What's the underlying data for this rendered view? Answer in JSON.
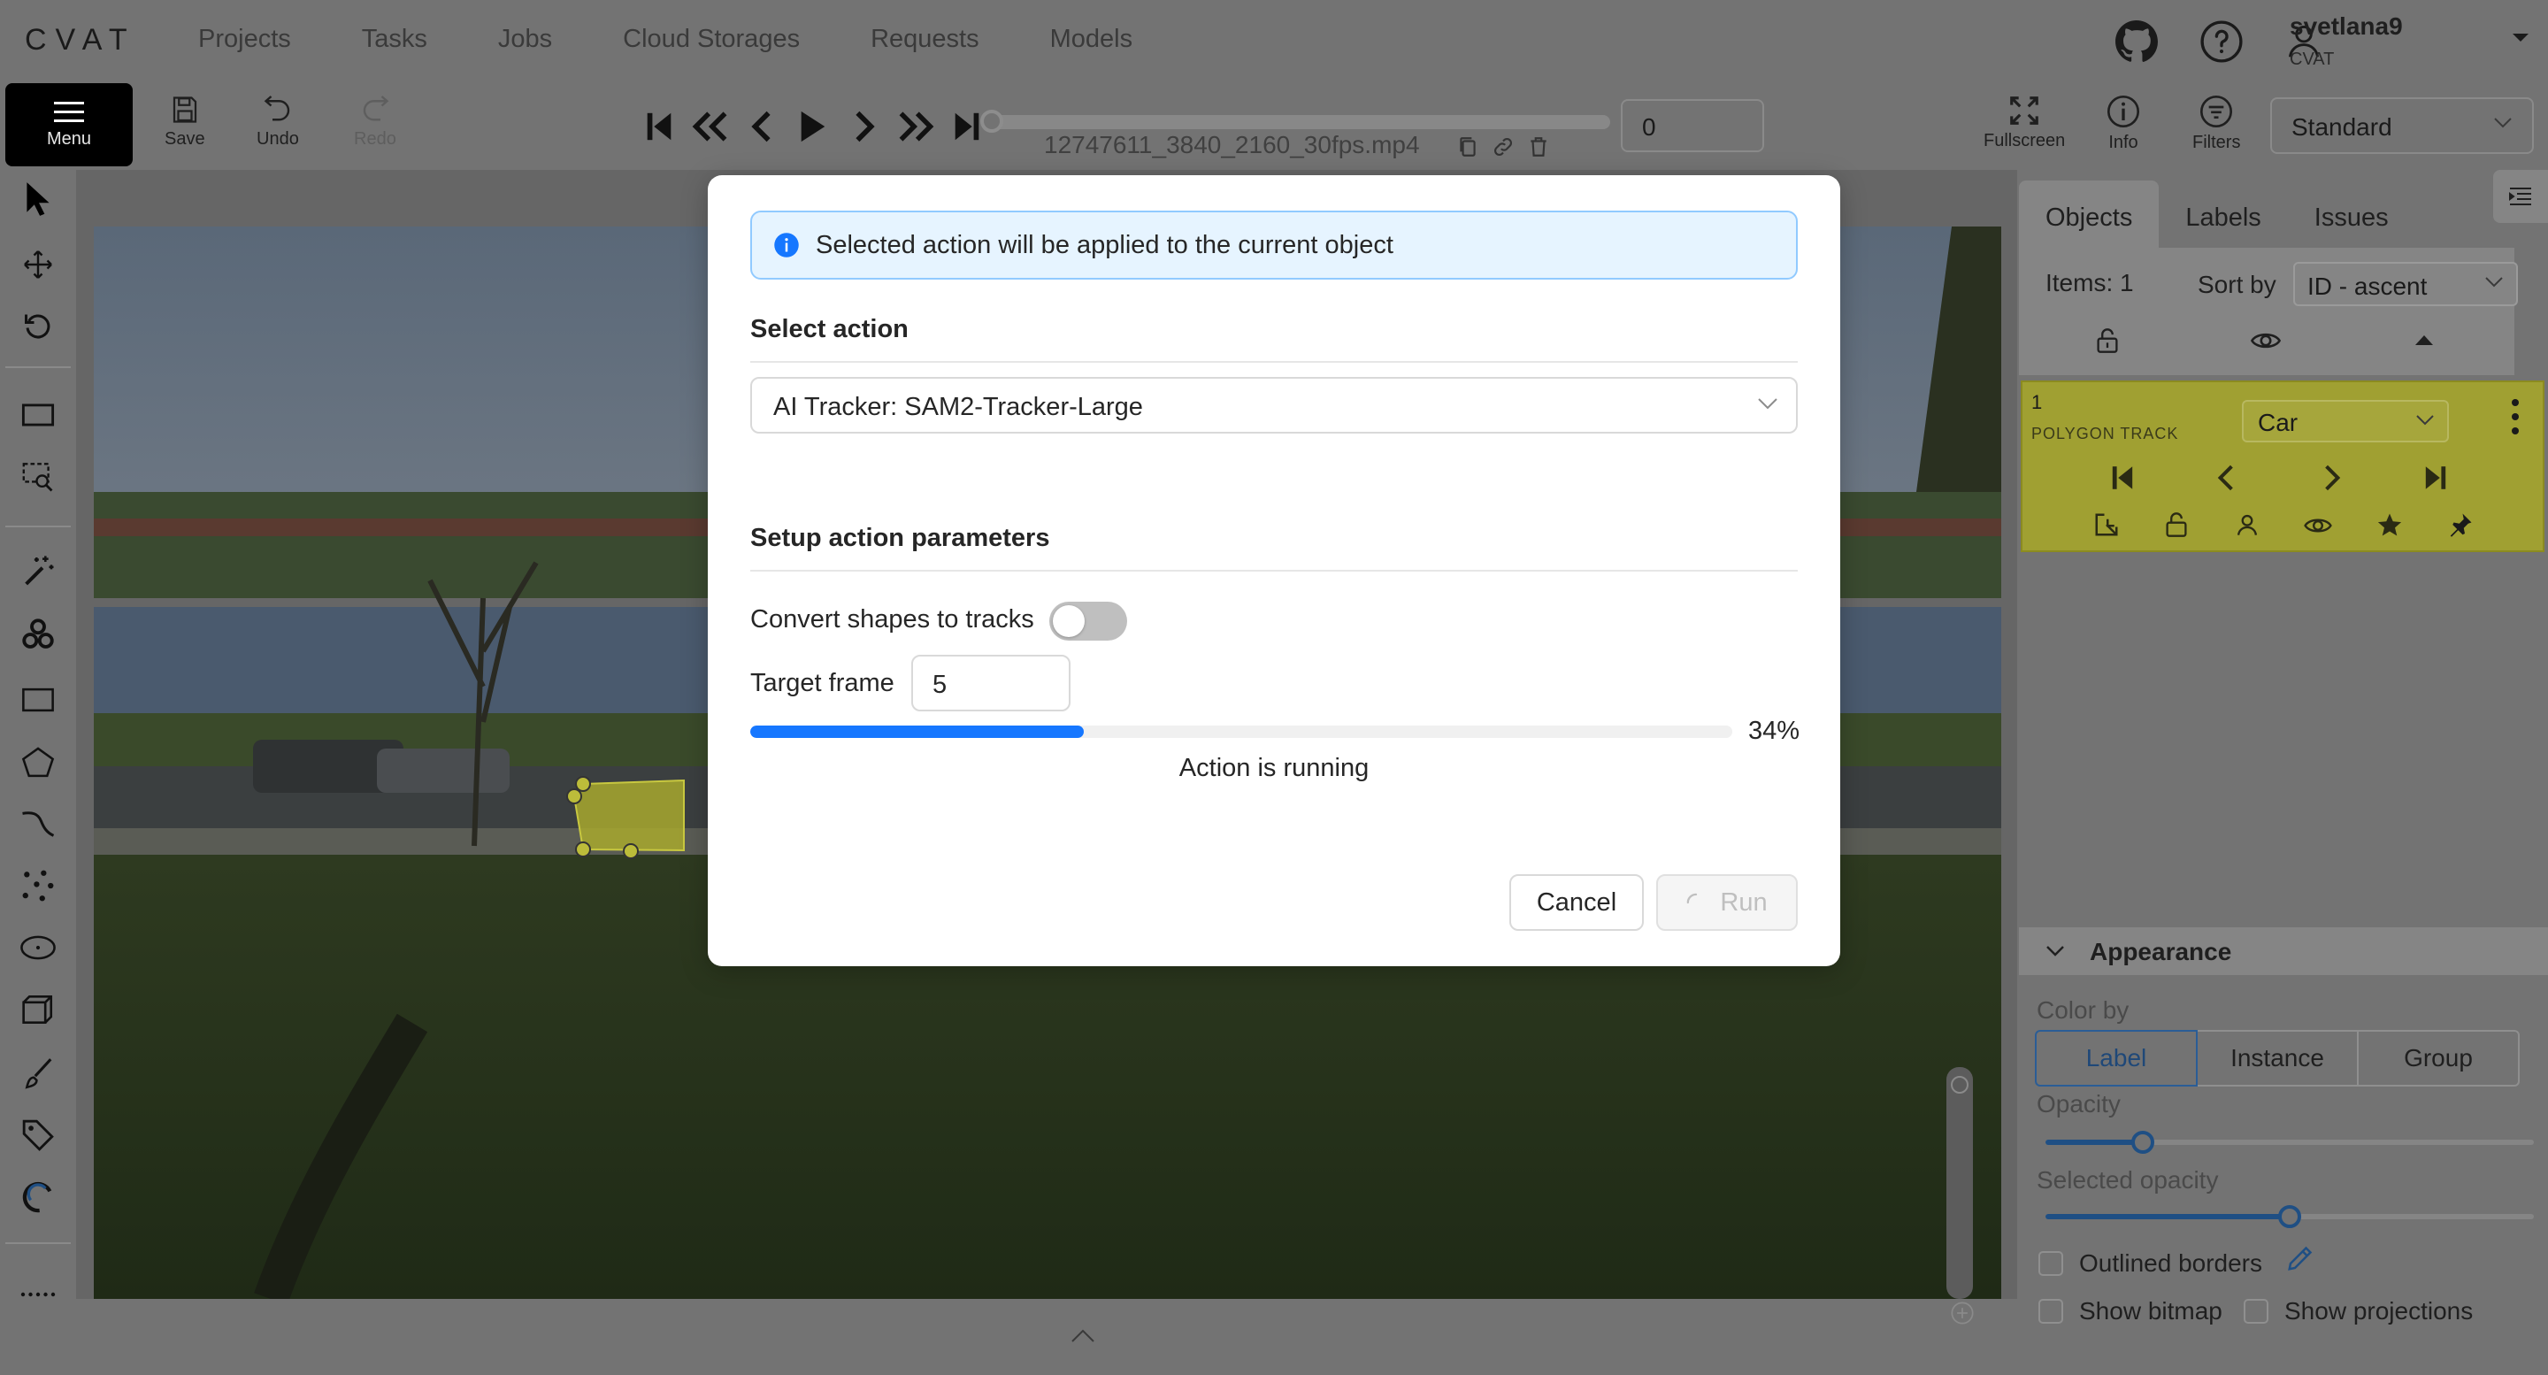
{
  "app": {
    "logo": "CVAT",
    "nav": [
      "Projects",
      "Tasks",
      "Jobs",
      "Cloud Storages",
      "Requests",
      "Models"
    ],
    "user": {
      "name": "svetlana9",
      "org": "CVAT"
    }
  },
  "toolbar": {
    "menu_label": "Menu",
    "save_label": "Save",
    "undo_label": "Undo",
    "redo_label": "Redo",
    "filename": "12747611_3840_2160_30fps.mp4",
    "frame_value": "0",
    "fullscreen_label": "Fullscreen",
    "info_label": "Info",
    "filters_label": "Filters",
    "workspace": "Standard"
  },
  "sidebar": {
    "tabs": [
      "Objects",
      "Labels",
      "Issues"
    ],
    "items_label": "Items: 1",
    "sort_label": "Sort by",
    "sort_value": "ID - ascent",
    "object": {
      "id": "1",
      "type": "POLYGON TRACK",
      "label": "Car",
      "color": "#a0a032"
    },
    "appearance": {
      "title": "Appearance",
      "color_by_label": "Color by",
      "color_by_options": [
        "Label",
        "Instance",
        "Group"
      ],
      "color_by_selected": "Label",
      "opacity_label": "Opacity",
      "opacity_value": 0.2,
      "selected_opacity_label": "Selected opacity",
      "selected_opacity_value": 0.5,
      "outlined_borders_label": "Outlined borders",
      "show_bitmap_label": "Show bitmap",
      "show_projections_label": "Show projections"
    }
  },
  "modal": {
    "info_text": "Selected action will be applied to the current object",
    "select_action_title": "Select action",
    "action_value": "AI Tracker: SAM2-Tracker-Large",
    "setup_title": "Setup action parameters",
    "convert_label": "Convert shapes to tracks",
    "convert_on": false,
    "target_frame_label": "Target frame",
    "target_frame_value": "5",
    "progress_percent": 34,
    "progress_text": "34%",
    "status_text": "Action is running",
    "cancel_label": "Cancel",
    "run_label": "Run",
    "accent_color": "#1677ff"
  }
}
